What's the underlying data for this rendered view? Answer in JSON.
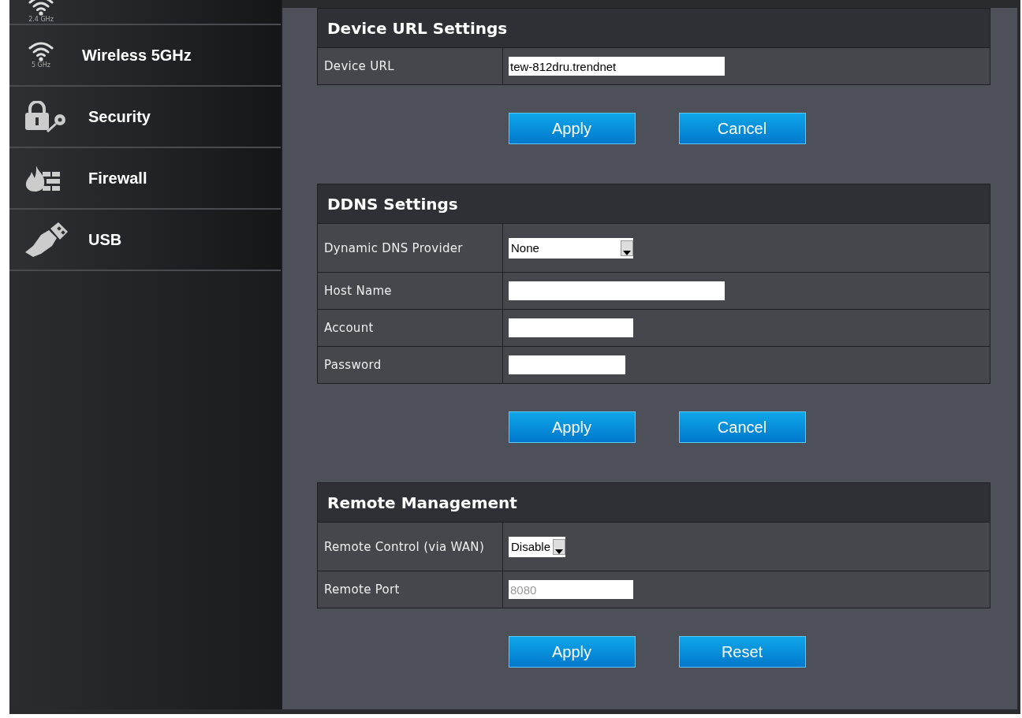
{
  "sidebar": {
    "items": [
      {
        "caption": "2.4 GHz"
      },
      {
        "label": "Wireless 5GHz",
        "caption": "5 GHz"
      },
      {
        "label": "Security"
      },
      {
        "label": "Firewall"
      },
      {
        "label": "USB"
      }
    ]
  },
  "sections": [
    {
      "title": "Device URL Settings",
      "rows": [
        {
          "label": "Device URL",
          "kind": "text",
          "value": "tew-812dru.trendnet"
        }
      ],
      "buttons": [
        "Apply",
        "Cancel"
      ]
    },
    {
      "title": "DDNS Settings",
      "rows": [
        {
          "label": "Dynamic DNS Provider",
          "kind": "select",
          "value": "None"
        },
        {
          "label": "Host Name",
          "kind": "text"
        },
        {
          "label": "Account",
          "kind": "text"
        },
        {
          "label": "Password",
          "kind": "text"
        }
      ],
      "buttons": [
        "Apply",
        "Cancel"
      ]
    },
    {
      "title": "Remote Management",
      "rows": [
        {
          "label": "Remote Control (via WAN)",
          "kind": "select",
          "value": "Disable"
        },
        {
          "label": "Remote Port",
          "kind": "text",
          "value": "8080",
          "disabled": true
        }
      ],
      "buttons": [
        "Apply",
        "Reset"
      ]
    }
  ]
}
